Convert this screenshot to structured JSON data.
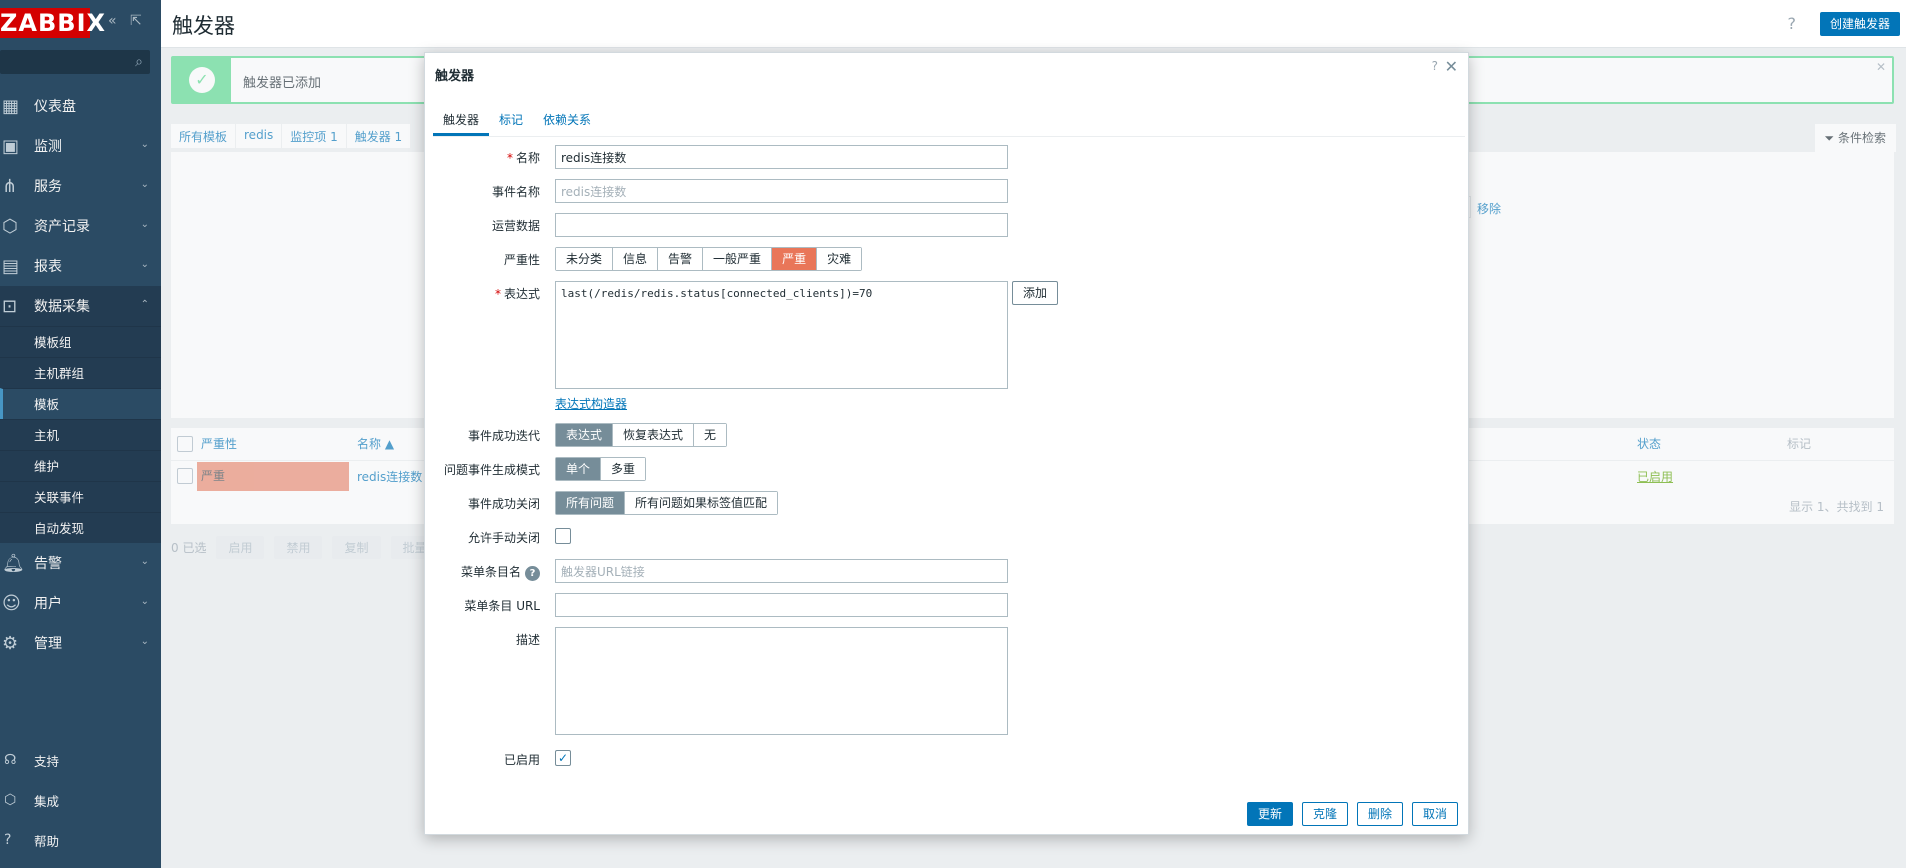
{
  "sidebar": {
    "logo": "ZABBIX",
    "menu": [
      {
        "label": "仪表盘",
        "icon": "dashboard-icon"
      },
      {
        "label": "监测",
        "icon": "monitoring-icon"
      },
      {
        "label": "服务",
        "icon": "services-icon"
      },
      {
        "label": "资产记录",
        "icon": "inventory-icon"
      },
      {
        "label": "报表",
        "icon": "reports-icon"
      },
      {
        "label": "数据采集",
        "icon": "data-collection-icon"
      }
    ],
    "submenu": [
      "模板组",
      "主机群组",
      "模板",
      "主机",
      "维护",
      "关联事件",
      "自动发现"
    ],
    "menu2": [
      {
        "label": "告警",
        "icon": "alerts-icon"
      },
      {
        "label": "用户",
        "icon": "users-icon"
      },
      {
        "label": "管理",
        "icon": "admin-icon"
      }
    ],
    "bottom": [
      {
        "label": "支持",
        "icon": "support-icon"
      },
      {
        "label": "集成",
        "icon": "integrations-icon"
      },
      {
        "label": "帮助",
        "icon": "help-icon"
      }
    ]
  },
  "header": {
    "title": "触发器",
    "create_button": "创建触发器"
  },
  "message": {
    "text": "触发器已添加"
  },
  "breadcrumb": [
    "所有模板",
    "redis",
    "监控项 1",
    "触发器 1"
  ],
  "filter": {
    "tab_label": "条件检索",
    "remove_label": "移除"
  },
  "table": {
    "headers": {
      "severity": "严重性",
      "name": "名称 ▲",
      "status": "状态",
      "tags": "标记"
    },
    "row": {
      "severity": "严重",
      "name": "redis连接数",
      "status": "已启用"
    },
    "footer": "显示 1、共找到 1"
  },
  "actions": {
    "selected": "0 已选",
    "buttons": [
      "启用",
      "禁用",
      "复制",
      "批量"
    ]
  },
  "dialog": {
    "title": "触发器",
    "tabs": [
      "触发器",
      "标记",
      "依赖关系"
    ],
    "fields": {
      "name_label": "名称",
      "name_value": "redis连接数",
      "event_name_label": "事件名称",
      "event_name_placeholder": "redis连接数",
      "opdata_label": "运营数据",
      "opdata_value": "",
      "severity_label": "严重性",
      "severity_options": [
        "未分类",
        "信息",
        "告警",
        "一般严重",
        "严重",
        "灾难"
      ],
      "severity_selected": "严重",
      "expression_label": "表达式",
      "expression_value": "last(/redis/redis.status[connected_clients])=70",
      "add_button": "添加",
      "expr_builder": "表达式构造器",
      "ok_event_gen_label": "事件成功迭代",
      "ok_event_gen_options": [
        "表达式",
        "恢复表达式",
        "无"
      ],
      "problem_mode_label": "问题事件生成模式",
      "problem_mode_options": [
        "单个",
        "多重"
      ],
      "ok_close_label": "事件成功关闭",
      "ok_close_options": [
        "所有问题",
        "所有问题如果标签值匹配"
      ],
      "manual_close_label": "允许手动关闭",
      "menu_name_label": "菜单条目名",
      "menu_name_placeholder": "触发器URL链接",
      "menu_url_label": "菜单条目 URL",
      "desc_label": "描述",
      "enabled_label": "已启用"
    },
    "buttons": {
      "update": "更新",
      "clone": "克隆",
      "delete": "删除",
      "cancel": "取消"
    }
  },
  "colors": {
    "accent": "#0275b8",
    "sidebar": "#2b4b64",
    "critical": "#e97659",
    "success": "#59db8f"
  }
}
